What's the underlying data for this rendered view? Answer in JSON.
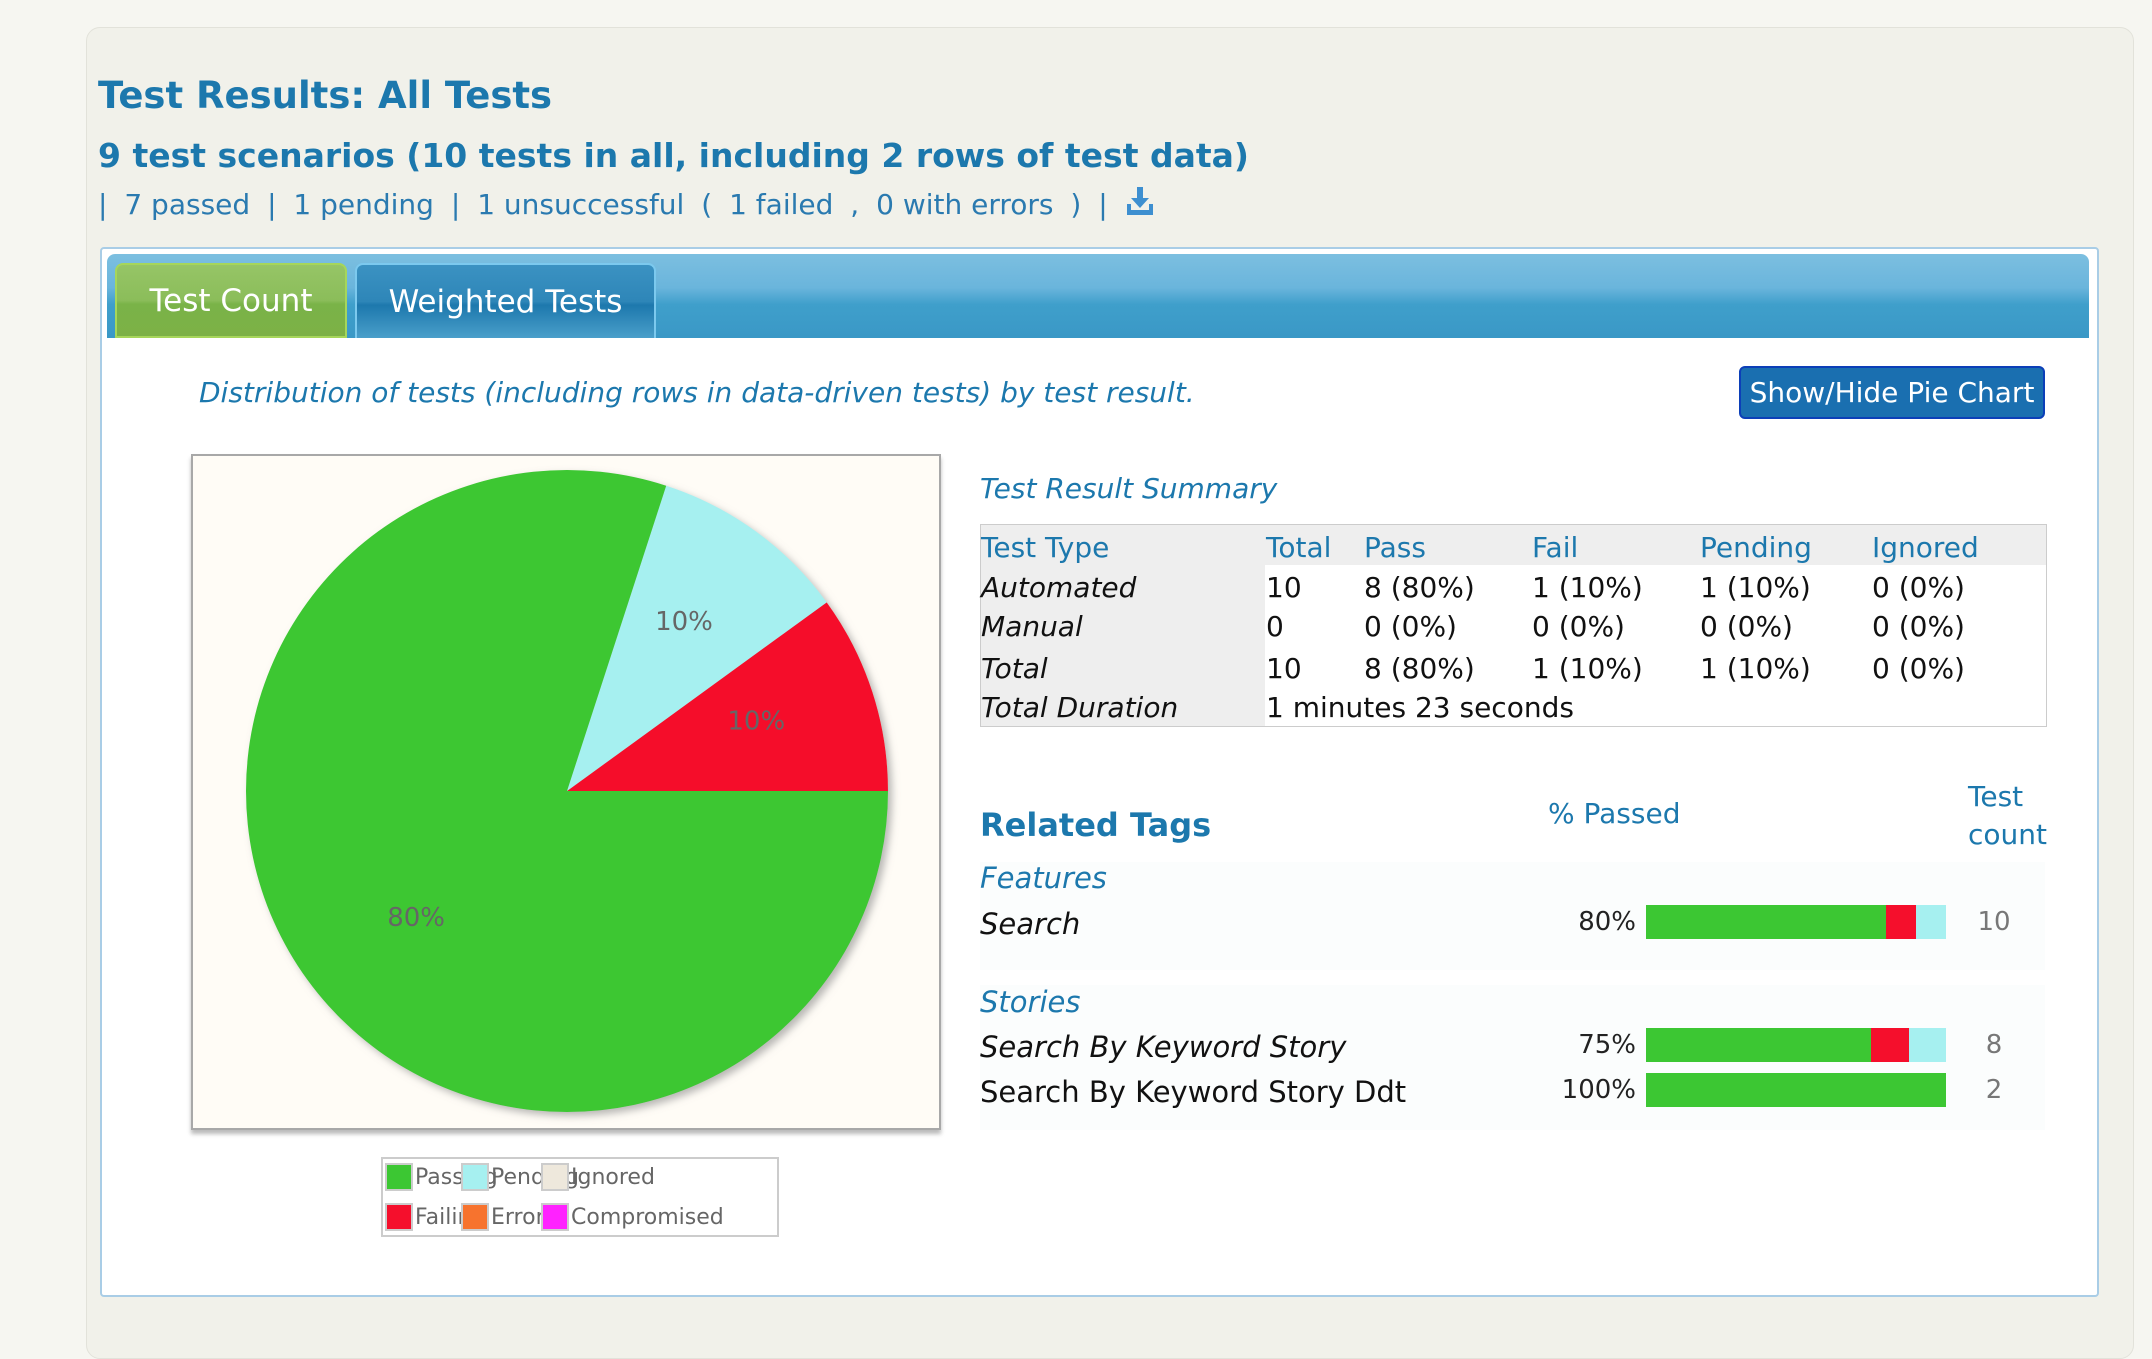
{
  "header": {
    "title": "Test Results: All Tests",
    "subtitle": "9 test scenarios (10 tests in all, including 2 rows of test data)",
    "summary": {
      "sep": "|",
      "passed": "7 passed",
      "pending": "1 pending",
      "unsuccessful": "1 unsuccessful",
      "open": "(",
      "failed": "1 failed",
      "comma": ",",
      "errors": "0 with errors",
      "close": ")",
      "download_icon": "download-icon"
    }
  },
  "tabs": [
    {
      "label": "Test Count",
      "active": true
    },
    {
      "label": "Weighted Tests",
      "active": false
    }
  ],
  "description": "Distribution of tests (including rows in data-driven tests) by test result.",
  "toggle_button": "Show/Hide Pie Chart",
  "colors": {
    "passing": "#3cc733",
    "pending": "#a6f0f0",
    "ignored": "#eee8dc",
    "failing": "#f50f2c",
    "errors": "#f7732e",
    "compromised": "#ff22ff"
  },
  "chart_data": {
    "type": "pie",
    "slices": [
      {
        "name": "Passing",
        "value": 80,
        "label": "80%"
      },
      {
        "name": "Pending",
        "value": 10,
        "label": "10%"
      },
      {
        "name": "Failing",
        "value": 10,
        "label": "10%"
      }
    ],
    "legend": [
      "Passing",
      "Pending",
      "Ignored",
      "Failing",
      "Errors",
      "Compromised"
    ],
    "legend_placement": "bottom"
  },
  "summary_table": {
    "title": "Test Result Summary",
    "headers": [
      "Test Type",
      "Total",
      "Pass",
      "Fail",
      "Pending",
      "Ignored"
    ],
    "rows": [
      [
        "Automated",
        "10",
        "8 (80%)",
        "1 (10%)",
        "1 (10%)",
        "0 (0%)"
      ],
      [
        "Manual",
        "0",
        "0 (0%)",
        "0 (0%)",
        "0 (0%)",
        "0 (0%)"
      ],
      [
        "Total",
        "10",
        "8 (80%)",
        "1 (10%)",
        "1 (10%)",
        "0 (0%)"
      ]
    ],
    "duration_label": "Total Duration",
    "duration": "1 minutes 23 seconds"
  },
  "related_tags": {
    "title": "Related Tags",
    "pct_header": "% Passed",
    "count_header_1": "Test",
    "count_header_2": "count",
    "groups": [
      {
        "name": "Features",
        "items": [
          {
            "name": "Search",
            "pct": "80%",
            "passing": 80,
            "failing": 10,
            "pending": 10,
            "count": "10"
          }
        ]
      },
      {
        "name": "Stories",
        "items": [
          {
            "name": "Search By Keyword Story",
            "pct": "75%",
            "passing": 75,
            "failing": 12.5,
            "pending": 12.5,
            "count": "8"
          },
          {
            "name": "Search By Keyword Story Ddt",
            "pct": "100%",
            "passing": 100,
            "failing": 0,
            "pending": 0,
            "count": "2"
          }
        ]
      }
    ]
  }
}
